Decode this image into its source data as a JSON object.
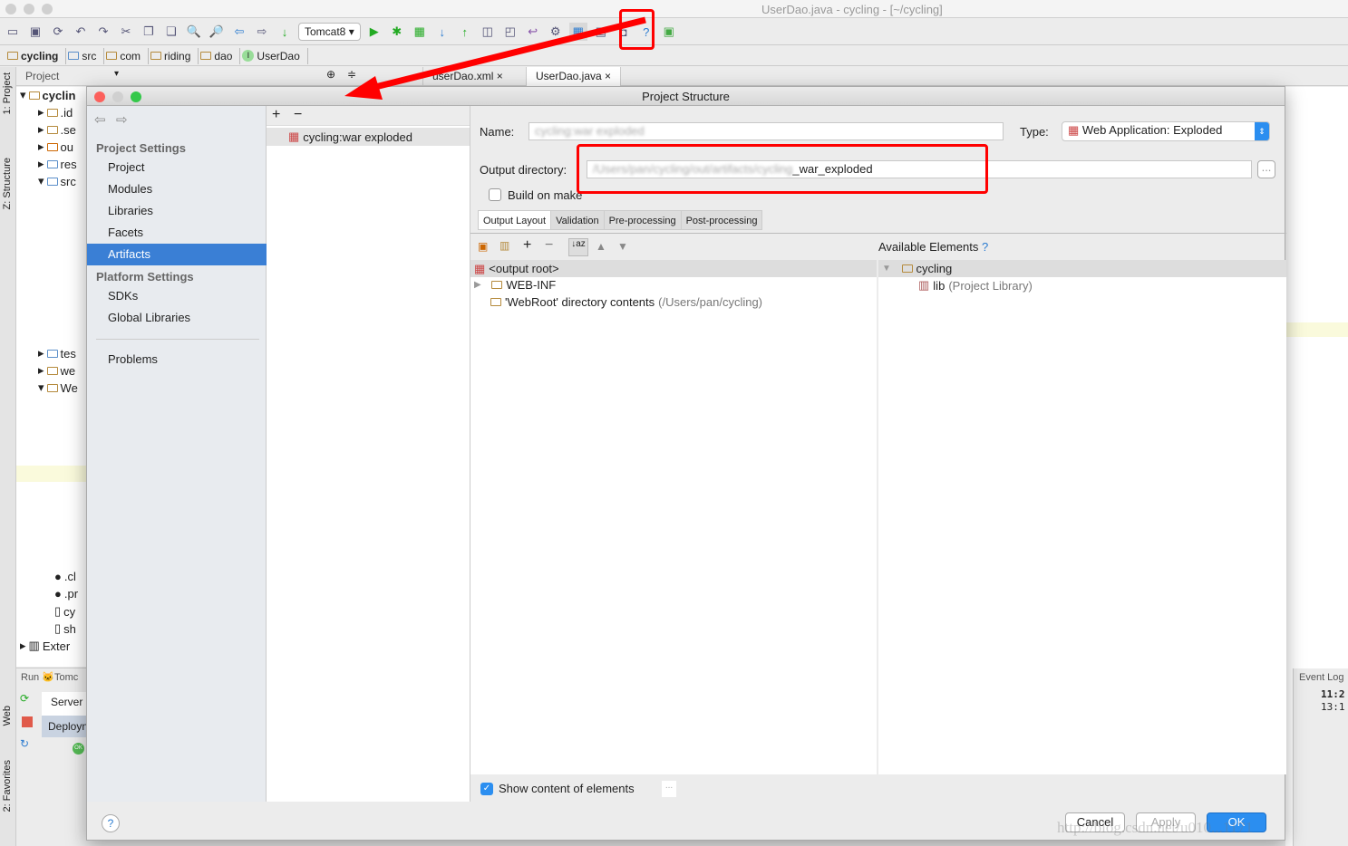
{
  "window": {
    "title": "UserDao.java - cycling - [~/cycling]"
  },
  "toolbar": {
    "run_config": "Tomcat8",
    "icons": [
      "open-folder",
      "save",
      "sync",
      "undo",
      "redo",
      "cut",
      "copy",
      "paste",
      "find",
      "replace",
      "back",
      "forward",
      "build",
      "run",
      "debug",
      "coverage",
      "vcs-update",
      "vcs-commit",
      "vcs-history",
      "vcs-revert",
      "project-structure",
      "android-sdk",
      "android-device",
      "help",
      "sdk-manager"
    ]
  },
  "breadcrumb": [
    "cycling",
    "src",
    "com",
    "riding",
    "dao",
    "UserDao"
  ],
  "editor_tabs": [
    {
      "label": "userDao.xml"
    },
    {
      "label": "UserDao.java"
    }
  ],
  "project_panel": {
    "title": "Project",
    "root": "cyclin",
    "items": [
      ".id",
      ".se",
      "ou",
      "res",
      "src",
      "tes",
      "we",
      "We",
      ".cl",
      ".pr",
      "cy",
      "sh",
      "Exter"
    ]
  },
  "side_tabs": {
    "project": "1: Project",
    "structure": "Z: Structure",
    "web": "Web",
    "favorites": "2: Favorites"
  },
  "run_panel": {
    "title": "Run",
    "config": "Tomc",
    "server_tab": "Server",
    "deploy_tab": "Deployn",
    "status": "OK"
  },
  "event_log": {
    "title": "Event Log",
    "times": [
      "11:2",
      "13:1"
    ]
  },
  "dialog": {
    "title": "Project Structure",
    "nav": {
      "project_settings_header": "Project Settings",
      "project_items": [
        "Project",
        "Modules",
        "Libraries",
        "Facets",
        "Artifacts"
      ],
      "selected": "Artifacts",
      "platform_header": "Platform Settings",
      "platform_items": [
        "SDKs",
        "Global Libraries"
      ],
      "problems": "Problems"
    },
    "artifacts": [
      "cycling:war exploded"
    ],
    "name_label": "Name:",
    "name_value": "cycling:war exploded",
    "type_label": "Type:",
    "type_value": "Web Application: Exploded",
    "output_label": "Output directory:",
    "output_blurred": "/Users/pan/cycling/out/artifacts/cycling",
    "output_suffix": "_war_exploded",
    "build_on_make": {
      "label": "Build on make",
      "checked": false
    },
    "tabs": [
      "Output Layout",
      "Validation",
      "Pre-processing",
      "Post-processing"
    ],
    "active_tab": "Output Layout",
    "layout_tree": [
      {
        "label": "<output root>"
      },
      {
        "label": "WEB-INF"
      },
      {
        "label": "'WebRoot' directory contents",
        "hint": "(/Users/pan/cycling)"
      }
    ],
    "available_title": "Available Elements",
    "available_help": "?",
    "available_tree": [
      {
        "label": "cycling"
      },
      {
        "label": "lib",
        "hint": "(Project Library)"
      }
    ],
    "show_content": {
      "label": "Show content of elements",
      "checked": true
    },
    "buttons": {
      "cancel": "Cancel",
      "apply": "Apply",
      "ok": "OK",
      "help": "?",
      "more": "..."
    }
  },
  "watermark": "http://blog.csdn.net/u010...1171",
  "colors": {
    "selection": "#3a7fd5",
    "annotation_red": "#ff0000",
    "ok_button": "#2b8ef0"
  }
}
